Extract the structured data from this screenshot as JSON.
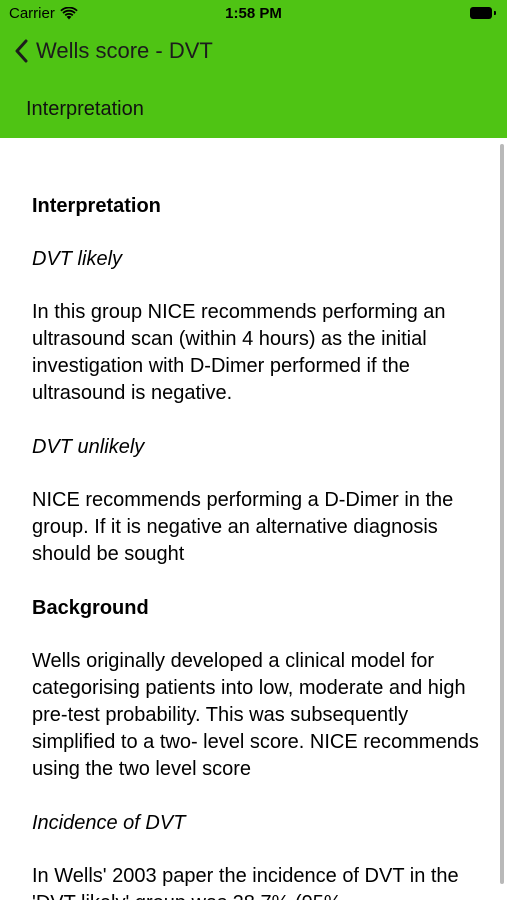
{
  "status": {
    "carrier": "Carrier",
    "time": "1:58 PM",
    "icons": [
      "wifi-icon",
      "battery-icon"
    ]
  },
  "nav": {
    "back_label": "Wells score - DVT",
    "section_title": "Interpretation"
  },
  "colors": {
    "header": "#4fc414",
    "background": "#ffffff",
    "text": "#000000"
  },
  "content": {
    "heading_interpretation": "Interpretation",
    "sub_likely": "DVT likely",
    "para_likely": "In this group NICE recommends performing an ultrasound scan (within 4 hours) as the initial investigation with D-Dimer performed if the ultrasound is negative.",
    "sub_unlikely": "DVT unlikely",
    "para_unlikely": "NICE recommends performing a D-Dimer in the group. If it is negative an alternative diagnosis should be sought",
    "heading_background": "Background",
    "para_background": "Wells originally developed a clinical model for categorising patients into low, moderate and high pre-test probability. This was subsequently simplified to a two- level score. NICE recommends using the two level score",
    "sub_incidence": "Incidence of DVT",
    "para_incidence": "In Wells' 2003 paper the incidence of DVT in the 'DVT likely' group was 28.7% (95%"
  }
}
